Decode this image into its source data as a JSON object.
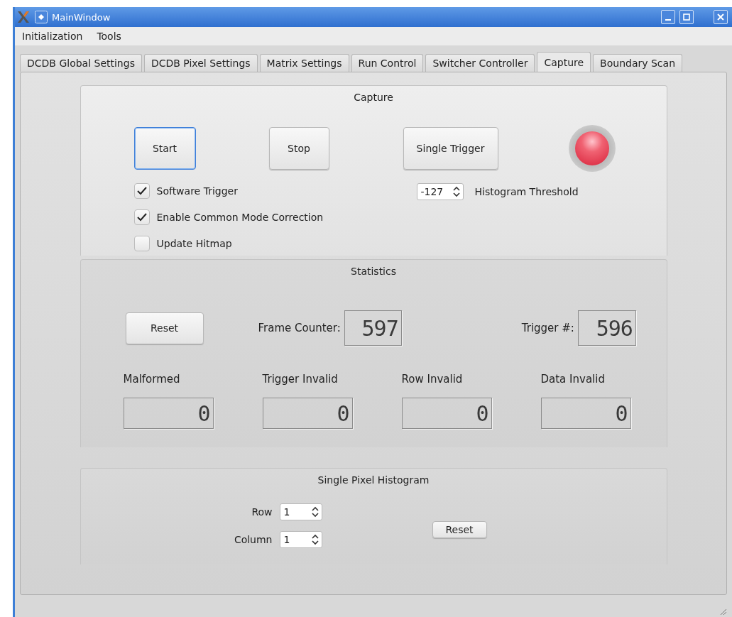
{
  "window": {
    "title": "MainWindow"
  },
  "menu": [
    "Initialization",
    "Tools"
  ],
  "tabs": [
    {
      "label": "DCDB Global Settings",
      "selected": false
    },
    {
      "label": "DCDB Pixel Settings",
      "selected": false
    },
    {
      "label": "Matrix Settings",
      "selected": false
    },
    {
      "label": "Run Control",
      "selected": false
    },
    {
      "label": "Switcher Controller",
      "selected": false
    },
    {
      "label": "Capture",
      "selected": true
    },
    {
      "label": "Boundary Scan",
      "selected": false
    }
  ],
  "capture": {
    "title": "Capture",
    "buttons": [
      {
        "label": "Start",
        "focused": true
      },
      {
        "label": "Stop",
        "focused": false
      },
      {
        "label": "Single Trigger",
        "focused": false
      }
    ],
    "indicator": {
      "on": true
    },
    "checkboxes": [
      {
        "label": "Software Trigger",
        "checked": true
      },
      {
        "label": "Enable Common Mode Correction",
        "checked": true
      },
      {
        "label": "Update Hitmap",
        "checked": false
      }
    ],
    "threshold": {
      "value": "-127",
      "label": "Histogram Threshold"
    }
  },
  "statistics": {
    "title": "Statistics",
    "reset": "Reset",
    "frame_counter": {
      "label": "Frame Counter:",
      "value": "597"
    },
    "trigger_count": {
      "label": "Trigger #:",
      "value": "596"
    },
    "counters": [
      {
        "label": "Malformed",
        "value": "0"
      },
      {
        "label": "Trigger Invalid",
        "value": "0"
      },
      {
        "label": "Row Invalid",
        "value": "0"
      },
      {
        "label": "Data Invalid",
        "value": "0"
      }
    ]
  },
  "histogram": {
    "title": "Single Pixel Histogram",
    "row": {
      "label": "Row",
      "value": "1"
    },
    "column": {
      "label": "Column",
      "value": "1"
    },
    "reset": "Reset"
  }
}
